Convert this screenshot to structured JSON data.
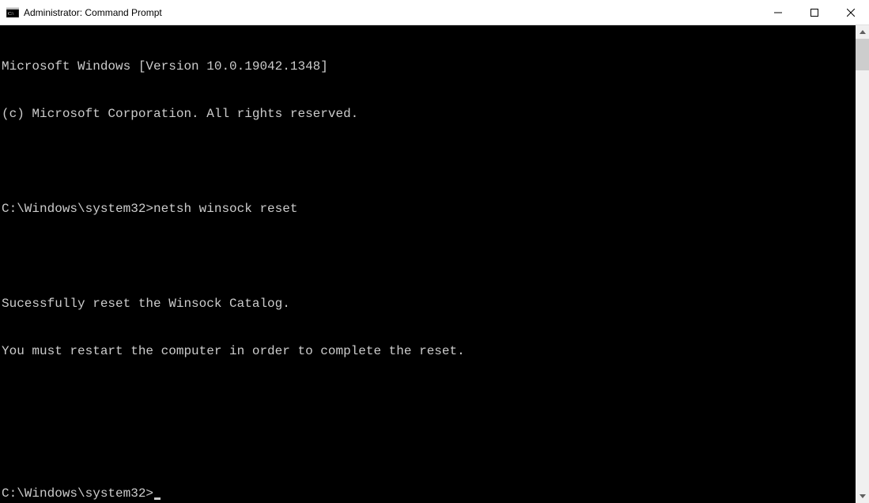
{
  "window": {
    "title": "Administrator: Command Prompt"
  },
  "terminal": {
    "lines": {
      "l0": "Microsoft Windows [Version 10.0.19042.1348]",
      "l1": "(c) Microsoft Corporation. All rights reserved.",
      "l2": "",
      "prompt1": "C:\\Windows\\system32>",
      "cmd1": "netsh winsock reset",
      "l4": "",
      "l5": "Sucessfully reset the Winsock Catalog.",
      "l6": "You must restart the computer in order to complete the reset.",
      "l7": "",
      "l8": "",
      "prompt2": "C:\\Windows\\system32>"
    }
  }
}
